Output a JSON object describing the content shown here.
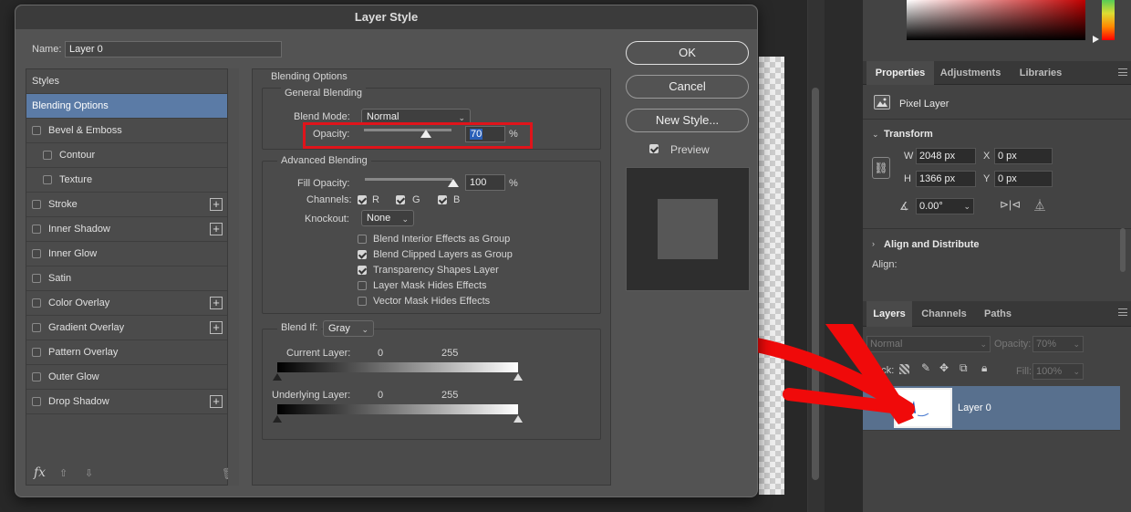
{
  "dialog": {
    "title": "Layer Style",
    "name_label": "Name:",
    "name_value": "Layer 0",
    "styles_header": "Styles",
    "styles": [
      {
        "label": "Blending Options",
        "checkbox": false,
        "plus": false,
        "selected": true,
        "indent": false
      },
      {
        "label": "Bevel & Emboss",
        "checkbox": true,
        "plus": false,
        "selected": false,
        "indent": false
      },
      {
        "label": "Contour",
        "checkbox": true,
        "plus": false,
        "selected": false,
        "indent": true
      },
      {
        "label": "Texture",
        "checkbox": true,
        "plus": false,
        "selected": false,
        "indent": true
      },
      {
        "label": "Stroke",
        "checkbox": true,
        "plus": true,
        "selected": false,
        "indent": false
      },
      {
        "label": "Inner Shadow",
        "checkbox": true,
        "plus": true,
        "selected": false,
        "indent": false
      },
      {
        "label": "Inner Glow",
        "checkbox": true,
        "plus": false,
        "selected": false,
        "indent": false
      },
      {
        "label": "Satin",
        "checkbox": true,
        "plus": false,
        "selected": false,
        "indent": false
      },
      {
        "label": "Color Overlay",
        "checkbox": true,
        "plus": true,
        "selected": false,
        "indent": false
      },
      {
        "label": "Gradient Overlay",
        "checkbox": true,
        "plus": true,
        "selected": false,
        "indent": false
      },
      {
        "label": "Pattern Overlay",
        "checkbox": true,
        "plus": false,
        "selected": false,
        "indent": false
      },
      {
        "label": "Outer Glow",
        "checkbox": true,
        "plus": false,
        "selected": false,
        "indent": false
      },
      {
        "label": "Drop Shadow",
        "checkbox": true,
        "plus": true,
        "selected": false,
        "indent": false
      }
    ],
    "fx_label": "fx",
    "blending_options_title": "Blending Options",
    "general_blending_title": "General Blending",
    "blend_mode_label": "Blend Mode:",
    "blend_mode_value": "Normal",
    "opacity_label": "Opacity:",
    "opacity_value": "70",
    "opacity_level": 0.7,
    "percent": "%",
    "advanced_blending_title": "Advanced Blending",
    "fill_opacity_label": "Fill Opacity:",
    "fill_opacity_value": "100",
    "channels_label": "Channels:",
    "channel_r": "R",
    "channel_g": "G",
    "channel_b": "B",
    "knockout_label": "Knockout:",
    "knockout_value": "None",
    "options": [
      {
        "label": "Blend Interior Effects as Group",
        "checked": false
      },
      {
        "label": "Blend Clipped Layers as Group",
        "checked": true
      },
      {
        "label": "Transparency Shapes Layer",
        "checked": true
      },
      {
        "label": "Layer Mask Hides Effects",
        "checked": false
      },
      {
        "label": "Vector Mask Hides Effects",
        "checked": false
      }
    ],
    "blend_if_label": "Blend If:",
    "blend_if_value": "Gray",
    "current_layer_label": "Current Layer:",
    "underlying_layer_label": "Underlying Layer:",
    "range_low": "0",
    "range_high": "255",
    "ok_label": "OK",
    "cancel_label": "Cancel",
    "new_style_label": "New Style...",
    "preview_label": "Preview"
  },
  "properties": {
    "tabs": [
      "Properties",
      "Adjustments",
      "Libraries"
    ],
    "pixel_layer": "Pixel Layer",
    "transform_title": "Transform",
    "w_label": "W",
    "w_value": "2048 px",
    "h_label": "H",
    "h_value": "1366 px",
    "x_label": "X",
    "x_value": "0 px",
    "y_label": "Y",
    "y_value": "0 px",
    "angle_value": "0.00°",
    "align_title": "Align and Distribute",
    "align_label": "Align:"
  },
  "layers": {
    "tabs": [
      "Layers",
      "Channels",
      "Paths"
    ],
    "blend_mode": "Normal",
    "opacity_label": "Opacity:",
    "opacity_value": "70%",
    "lock_label": "Lock:",
    "fill_label": "Fill:",
    "fill_value": "100%",
    "layer_name": "Layer 0"
  },
  "colors": {
    "accent": "#5b7ba6",
    "highlight_box": "#e0141b",
    "arrow": "#f00a0a"
  }
}
